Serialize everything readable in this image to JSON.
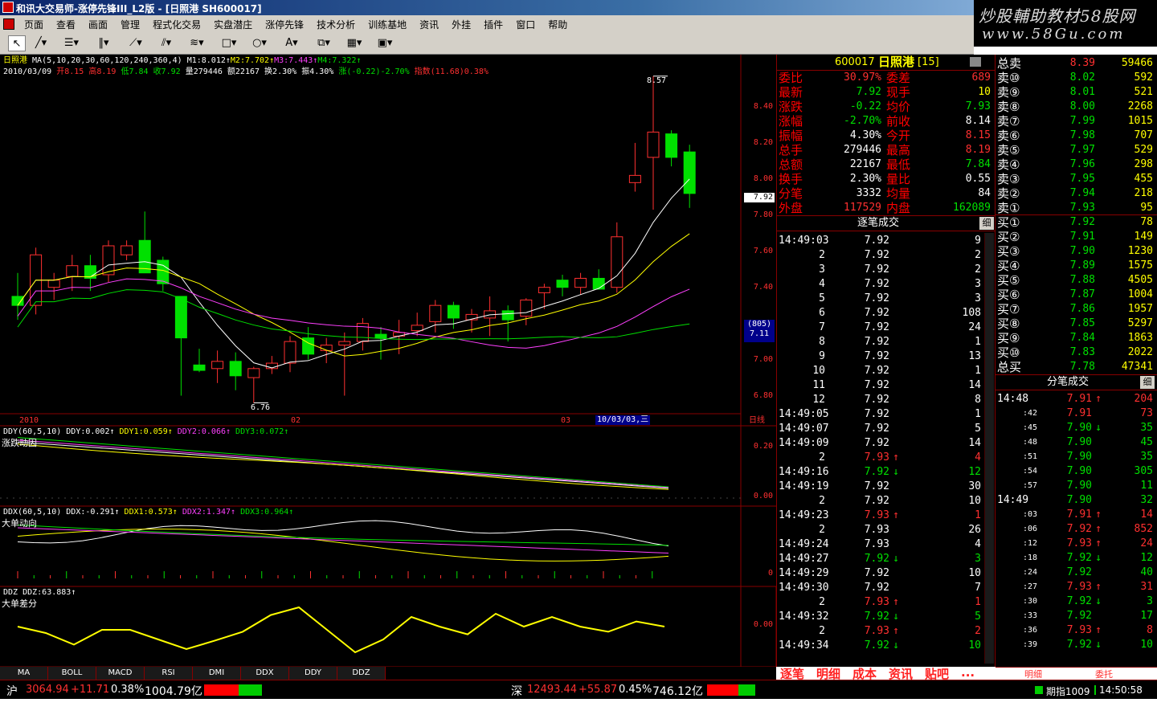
{
  "window": {
    "title": "和讯大交易师-涨停先锋III_L2版 - [日照港 SH600017]"
  },
  "watermark": {
    "line1": "炒股輔助教材58股网",
    "line2": "www.58Gu.com"
  },
  "menu": [
    "页面",
    "查看",
    "画面",
    "管理",
    "程式化交易",
    "实盘潜庄",
    "涨停先锋",
    "技术分析",
    "训练基地",
    "资讯",
    "外挂",
    "插件",
    "窗口",
    "帮助"
  ],
  "main_chart": {
    "stock_name": "日照港",
    "ma_line": "MA(5,10,20,30,60,120,240,360,4)",
    "ma_values": [
      {
        "text": "M1:8.012",
        "color": "#ffffff"
      },
      {
        "text": "M2:7.702",
        "color": "#ffff00"
      },
      {
        "text": "M3:7.443",
        "color": "#ff40ff"
      },
      {
        "text": "M4:7.322",
        "color": "#00e000"
      }
    ],
    "info_date": "2010/03/09",
    "info_items": [
      {
        "text": "开8.15",
        "color": "#ff3030"
      },
      {
        "text": "高8.19",
        "color": "#ff3030"
      },
      {
        "text": "低7.84",
        "color": "#00e000"
      },
      {
        "text": "收7.92",
        "color": "#00e000"
      },
      {
        "text": "量279446",
        "color": "#ffffff"
      },
      {
        "text": "额22167",
        "color": "#ffffff"
      },
      {
        "text": "换2.30%",
        "color": "#ffffff"
      },
      {
        "text": "振4.30%",
        "color": "#ffffff"
      },
      {
        "text": "涨(-0.22)-2.70%",
        "color": "#00e000"
      },
      {
        "text": "指数(11.68)0.38%",
        "color": "#ff3030"
      }
    ],
    "y_ticks": [
      "8.40",
      "8.20",
      "8.00",
      "7.80",
      "7.60",
      "7.40",
      "7.20",
      "7.00",
      "6.80"
    ],
    "current_price_tag": "7.92",
    "cursor_tag_top": "(805)",
    "cursor_tag_bottom": "7.11",
    "high_label": "8.57",
    "low_label": "6.76",
    "x_labels": [
      "2010",
      "02",
      "03"
    ],
    "date_tag": "10/03/03,三",
    "period": "日线"
  },
  "chart_data": {
    "type": "candlestick",
    "ylim": [
      6.7,
      8.6
    ],
    "candles": [
      {
        "o": 7.35,
        "h": 7.48,
        "l": 7.22,
        "c": 7.3
      },
      {
        "o": 7.3,
        "h": 7.62,
        "l": 7.25,
        "c": 7.58
      },
      {
        "o": 7.4,
        "h": 7.48,
        "l": 7.33,
        "c": 7.44
      },
      {
        "o": 7.46,
        "h": 7.58,
        "l": 7.38,
        "c": 7.52
      },
      {
        "o": 7.52,
        "h": 7.58,
        "l": 7.38,
        "c": 7.45
      },
      {
        "o": 7.47,
        "h": 7.66,
        "l": 7.43,
        "c": 7.63
      },
      {
        "o": 7.58,
        "h": 7.66,
        "l": 7.55,
        "c": 7.63
      },
      {
        "o": 7.66,
        "h": 7.82,
        "l": 7.52,
        "c": 7.48
      },
      {
        "o": 7.55,
        "h": 7.57,
        "l": 7.38,
        "c": 7.42
      },
      {
        "o": 7.35,
        "h": 7.35,
        "l": 6.8,
        "c": 7.12
      },
      {
        "o": 6.97,
        "h": 7.06,
        "l": 6.93,
        "c": 6.94
      },
      {
        "o": 6.95,
        "h": 7.05,
        "l": 6.87,
        "c": 6.99
      },
      {
        "o": 6.99,
        "h": 7.04,
        "l": 6.83,
        "c": 6.91
      },
      {
        "o": 6.9,
        "h": 6.96,
        "l": 6.76,
        "c": 6.95
      },
      {
        "o": 6.95,
        "h": 7.02,
        "l": 6.92,
        "c": 6.98
      },
      {
        "o": 6.98,
        "h": 7.13,
        "l": 6.93,
        "c": 7.1
      },
      {
        "o": 7.12,
        "h": 7.18,
        "l": 7.0,
        "c": 7.03
      },
      {
        "o": 7.05,
        "h": 7.12,
        "l": 6.98,
        "c": 7.08
      },
      {
        "o": 7.08,
        "h": 7.15,
        "l": 6.8,
        "c": 7.1
      },
      {
        "o": 7.1,
        "h": 7.23,
        "l": 7.05,
        "c": 7.2
      },
      {
        "o": 7.14,
        "h": 7.18,
        "l": 7.0,
        "c": 7.12
      },
      {
        "o": 7.13,
        "h": 7.22,
        "l": 7.03,
        "c": 7.15
      },
      {
        "o": 7.16,
        "h": 7.26,
        "l": 7.13,
        "c": 7.19
      },
      {
        "o": 7.21,
        "h": 7.33,
        "l": 7.15,
        "c": 7.3
      },
      {
        "o": 7.3,
        "h": 7.32,
        "l": 7.17,
        "c": 7.23
      },
      {
        "o": 7.22,
        "h": 7.28,
        "l": 7.15,
        "c": 7.25
      },
      {
        "o": 7.23,
        "h": 7.35,
        "l": 7.13,
        "c": 7.27
      },
      {
        "o": 7.27,
        "h": 7.3,
        "l": 7.1,
        "c": 7.22
      },
      {
        "o": 7.24,
        "h": 7.34,
        "l": 7.19,
        "c": 7.33
      },
      {
        "o": 7.37,
        "h": 7.42,
        "l": 7.28,
        "c": 7.4
      },
      {
        "o": 7.44,
        "h": 7.47,
        "l": 7.35,
        "c": 7.4
      },
      {
        "o": 7.4,
        "h": 7.48,
        "l": 7.36,
        "c": 7.45
      },
      {
        "o": 7.45,
        "h": 7.5,
        "l": 7.4,
        "c": 7.39
      },
      {
        "o": 7.4,
        "h": 7.76,
        "l": 7.37,
        "c": 7.68
      },
      {
        "o": 7.98,
        "h": 8.2,
        "l": 7.93,
        "c": 8.02
      },
      {
        "o": 8.12,
        "h": 8.57,
        "l": 7.83,
        "c": 8.26
      },
      {
        "o": 8.25,
        "h": 8.27,
        "l": 8.07,
        "c": 8.12
      },
      {
        "o": 8.15,
        "h": 8.19,
        "l": 7.84,
        "c": 7.92
      }
    ]
  },
  "ddy": {
    "title": "DDY(60,5,10)",
    "values": [
      {
        "text": "DDY:0.002",
        "color": "#ffffff"
      },
      {
        "text": "DDY1:0.059",
        "color": "#ffff00"
      },
      {
        "text": "DDY2:0.066",
        "color": "#ff40ff"
      },
      {
        "text": "DDY3:0.072",
        "color": "#00e000"
      }
    ],
    "label": "涨跌动因",
    "y_ticks": [
      "0.20",
      "0.00"
    ]
  },
  "ddx": {
    "title": "DDX(60,5,10)",
    "values": [
      {
        "text": "DDX:-0.291",
        "color": "#ffffff"
      },
      {
        "text": "DDX1:0.573",
        "color": "#ffff00"
      },
      {
        "text": "DDX2:1.347",
        "color": "#ff40ff"
      },
      {
        "text": "DDX3:0.964",
        "color": "#00e000"
      }
    ],
    "label": "大单动向",
    "y_tick": "0"
  },
  "ddz": {
    "title": "DDZ",
    "value": "DDZ:63.883",
    "label": "大单差分",
    "y_tick": "0.00"
  },
  "indicator_tabs": [
    "MA",
    "BOLL",
    "MACD",
    "RSI",
    "DMI",
    "DDX",
    "DDY",
    "DDZ"
  ],
  "quote": {
    "code": "600017",
    "name": "日照港",
    "level": "[15]",
    "stats": [
      {
        "l1": "委比",
        "v1": "30.97%",
        "c1": "#ff3030",
        "l2": "委差",
        "v2": "689",
        "c2": "#ff3030"
      },
      {
        "l1": "最新",
        "v1": "7.92",
        "c1": "#00e000",
        "l2": "现手",
        "v2": "10",
        "c2": "#ffff00"
      },
      {
        "l1": "涨跌",
        "v1": "-0.22",
        "c1": "#00e000",
        "l2": "均价",
        "v2": "7.93",
        "c2": "#00e000"
      },
      {
        "l1": "涨幅",
        "v1": "-2.70%",
        "c1": "#00e000",
        "l2": "前收",
        "v2": "8.14",
        "c2": "#ffffff"
      },
      {
        "l1": "振幅",
        "v1": "4.30%",
        "c1": "#ffffff",
        "l2": "今开",
        "v2": "8.15",
        "c2": "#ff3030"
      },
      {
        "l1": "总手",
        "v1": "279446",
        "c1": "#ffffff",
        "l2": "最高",
        "v2": "8.19",
        "c2": "#ff3030"
      },
      {
        "l1": "总额",
        "v1": "22167",
        "c1": "#ffffff",
        "l2": "最低",
        "v2": "7.84",
        "c2": "#00e000"
      },
      {
        "l1": "换手",
        "v1": "2.30%",
        "c1": "#ffffff",
        "l2": "量比",
        "v2": "0.55",
        "c2": "#ffffff"
      },
      {
        "l1": "分笔",
        "v1": "3332",
        "c1": "#ffffff",
        "l2": "均量",
        "v2": "84",
        "c2": "#ffffff"
      },
      {
        "l1": "外盘",
        "v1": "117529",
        "c1": "#ff3030",
        "l2": "内盘",
        "v2": "162089",
        "c2": "#00e000"
      }
    ],
    "ticks_title": "逐笔成交",
    "ticks_btn": "细",
    "ticks": [
      {
        "t": "14:49:03",
        "p": "7.92",
        "pc": "#ffffff",
        "a": "",
        "v": "9",
        "vc": "#ffffff"
      },
      {
        "t": "2",
        "p": "7.92",
        "pc": "#ffffff",
        "a": "",
        "v": "2",
        "vc": "#ffffff"
      },
      {
        "t": "3",
        "p": "7.92",
        "pc": "#ffffff",
        "a": "",
        "v": "2",
        "vc": "#ffffff"
      },
      {
        "t": "4",
        "p": "7.92",
        "pc": "#ffffff",
        "a": "",
        "v": "3",
        "vc": "#ffffff"
      },
      {
        "t": "5",
        "p": "7.92",
        "pc": "#ffffff",
        "a": "",
        "v": "3",
        "vc": "#ffffff"
      },
      {
        "t": "6",
        "p": "7.92",
        "pc": "#ffffff",
        "a": "",
        "v": "108",
        "vc": "#ffffff"
      },
      {
        "t": "7",
        "p": "7.92",
        "pc": "#ffffff",
        "a": "",
        "v": "24",
        "vc": "#ffffff"
      },
      {
        "t": "8",
        "p": "7.92",
        "pc": "#ffffff",
        "a": "",
        "v": "1",
        "vc": "#ffffff"
      },
      {
        "t": "9",
        "p": "7.92",
        "pc": "#ffffff",
        "a": "",
        "v": "13",
        "vc": "#ffffff"
      },
      {
        "t": "10",
        "p": "7.92",
        "pc": "#ffffff",
        "a": "",
        "v": "1",
        "vc": "#ffffff"
      },
      {
        "t": "11",
        "p": "7.92",
        "pc": "#ffffff",
        "a": "",
        "v": "14",
        "vc": "#ffffff"
      },
      {
        "t": "12",
        "p": "7.92",
        "pc": "#ffffff",
        "a": "",
        "v": "8",
        "vc": "#ffffff"
      },
      {
        "t": "14:49:05",
        "p": "7.92",
        "pc": "#ffffff",
        "a": "",
        "v": "1",
        "vc": "#ffffff"
      },
      {
        "t": "14:49:07",
        "p": "7.92",
        "pc": "#ffffff",
        "a": "",
        "v": "5",
        "vc": "#ffffff"
      },
      {
        "t": "14:49:09",
        "p": "7.92",
        "pc": "#ffffff",
        "a": "",
        "v": "14",
        "vc": "#ffffff"
      },
      {
        "t": "2",
        "p": "7.93",
        "pc": "#ff3030",
        "a": "↑",
        "v": "4",
        "vc": "#ff3030"
      },
      {
        "t": "14:49:16",
        "p": "7.92",
        "pc": "#00e000",
        "a": "↓",
        "v": "12",
        "vc": "#00e000"
      },
      {
        "t": "14:49:19",
        "p": "7.92",
        "pc": "#ffffff",
        "a": "",
        "v": "30",
        "vc": "#ffffff"
      },
      {
        "t": "2",
        "p": "7.92",
        "pc": "#ffffff",
        "a": "",
        "v": "10",
        "vc": "#ffffff"
      },
      {
        "t": "14:49:23",
        "p": "7.93",
        "pc": "#ff3030",
        "a": "↑",
        "v": "1",
        "vc": "#ff3030"
      },
      {
        "t": "2",
        "p": "7.93",
        "pc": "#ffffff",
        "a": "",
        "v": "26",
        "vc": "#ffffff"
      },
      {
        "t": "14:49:24",
        "p": "7.93",
        "pc": "#ffffff",
        "a": "",
        "v": "4",
        "vc": "#ffffff"
      },
      {
        "t": "14:49:27",
        "p": "7.92",
        "pc": "#00e000",
        "a": "↓",
        "v": "3",
        "vc": "#00e000"
      },
      {
        "t": "14:49:29",
        "p": "7.92",
        "pc": "#ffffff",
        "a": "",
        "v": "10",
        "vc": "#ffffff"
      },
      {
        "t": "14:49:30",
        "p": "7.92",
        "pc": "#ffffff",
        "a": "",
        "v": "7",
        "vc": "#ffffff"
      },
      {
        "t": "2",
        "p": "7.93",
        "pc": "#ff3030",
        "a": "↑",
        "v": "1",
        "vc": "#ff3030"
      },
      {
        "t": "14:49:32",
        "p": "7.92",
        "pc": "#00e000",
        "a": "↓",
        "v": "5",
        "vc": "#00e000"
      },
      {
        "t": "2",
        "p": "7.93",
        "pc": "#ff3030",
        "a": "↑",
        "v": "2",
        "vc": "#ff3030"
      },
      {
        "t": "14:49:34",
        "p": "7.92",
        "pc": "#00e000",
        "a": "↓",
        "v": "10",
        "vc": "#00e000"
      }
    ],
    "bottom_tabs": [
      "逐笔",
      "明细",
      "成本",
      "资讯",
      "贴吧",
      "..."
    ]
  },
  "orderbook": {
    "total_sell": {
      "label": "总卖",
      "price": "8.39",
      "vol": "59466"
    },
    "sells": [
      {
        "l": "卖⑩",
        "p": "8.02",
        "v": "592"
      },
      {
        "l": "卖⑨",
        "p": "8.01",
        "v": "521"
      },
      {
        "l": "卖⑧",
        "p": "8.00",
        "v": "2268"
      },
      {
        "l": "卖⑦",
        "p": "7.99",
        "v": "1015"
      },
      {
        "l": "卖⑥",
        "p": "7.98",
        "v": "707"
      },
      {
        "l": "卖⑤",
        "p": "7.97",
        "v": "529"
      },
      {
        "l": "卖④",
        "p": "7.96",
        "v": "298"
      },
      {
        "l": "卖③",
        "p": "7.95",
        "v": "455"
      },
      {
        "l": "卖②",
        "p": "7.94",
        "v": "218"
      },
      {
        "l": "卖①",
        "p": "7.93",
        "v": "95"
      }
    ],
    "buys": [
      {
        "l": "买①",
        "p": "7.92",
        "v": "78"
      },
      {
        "l": "买②",
        "p": "7.91",
        "v": "149"
      },
      {
        "l": "买③",
        "p": "7.90",
        "v": "1230"
      },
      {
        "l": "买④",
        "p": "7.89",
        "v": "1575"
      },
      {
        "l": "买⑤",
        "p": "7.88",
        "v": "4505"
      },
      {
        "l": "买⑥",
        "p": "7.87",
        "v": "1004"
      },
      {
        "l": "买⑦",
        "p": "7.86",
        "v": "1957"
      },
      {
        "l": "买⑧",
        "p": "7.85",
        "v": "5297"
      },
      {
        "l": "买⑨",
        "p": "7.84",
        "v": "1863"
      },
      {
        "l": "买⑩",
        "p": "7.83",
        "v": "2022"
      }
    ],
    "total_buy": {
      "label": "总买",
      "price": "7.78",
      "vol": "47341"
    },
    "trades_title": "分笔成交",
    "trades_btn": "细",
    "trades": [
      {
        "t": "14:48",
        "p": "7.91",
        "pc": "#ff3030",
        "a": "↑",
        "v": "204",
        "vc": "#ff3030",
        "big": true
      },
      {
        "t": ":42",
        "p": "7.91",
        "pc": "#ff3030",
        "a": "",
        "v": "73",
        "vc": "#ff3030",
        "big": false
      },
      {
        "t": ":45",
        "p": "7.90",
        "pc": "#00e000",
        "a": "↓",
        "v": "35",
        "vc": "#00e000",
        "big": false
      },
      {
        "t": ":48",
        "p": "7.90",
        "pc": "#00e000",
        "a": "",
        "v": "45",
        "vc": "#00e000",
        "big": false
      },
      {
        "t": ":51",
        "p": "7.90",
        "pc": "#00e000",
        "a": "",
        "v": "35",
        "vc": "#00e000",
        "big": false
      },
      {
        "t": ":54",
        "p": "7.90",
        "pc": "#00e000",
        "a": "",
        "v": "305",
        "vc": "#00e000",
        "big": false
      },
      {
        "t": ":57",
        "p": "7.90",
        "pc": "#00e000",
        "a": "",
        "v": "11",
        "vc": "#00e000",
        "big": false
      },
      {
        "t": "14:49",
        "p": "7.90",
        "pc": "#00e000",
        "a": "",
        "v": "32",
        "vc": "#00e000",
        "big": true
      },
      {
        "t": ":03",
        "p": "7.91",
        "pc": "#ff3030",
        "a": "↑",
        "v": "14",
        "vc": "#ff3030",
        "big": false
      },
      {
        "t": ":06",
        "p": "7.92",
        "pc": "#ff3030",
        "a": "↑",
        "v": "852",
        "vc": "#ff3030",
        "big": false
      },
      {
        "t": ":12",
        "p": "7.93",
        "pc": "#ff3030",
        "a": "↑",
        "v": "24",
        "vc": "#ff3030",
        "big": false
      },
      {
        "t": ":18",
        "p": "7.92",
        "pc": "#00e000",
        "a": "↓",
        "v": "12",
        "vc": "#00e000",
        "big": false
      },
      {
        "t": ":24",
        "p": "7.92",
        "pc": "#00e000",
        "a": "",
        "v": "40",
        "vc": "#00e000",
        "big": false
      },
      {
        "t": ":27",
        "p": "7.93",
        "pc": "#ff3030",
        "a": "↑",
        "v": "31",
        "vc": "#ff3030",
        "big": false
      },
      {
        "t": ":30",
        "p": "7.92",
        "pc": "#00e000",
        "a": "↓",
        "v": "3",
        "vc": "#00e000",
        "big": false
      },
      {
        "t": ":33",
        "p": "7.92",
        "pc": "#00e000",
        "a": "",
        "v": "17",
        "vc": "#00e000",
        "big": false
      },
      {
        "t": ":36",
        "p": "7.93",
        "pc": "#ff3030",
        "a": "↑",
        "v": "8",
        "vc": "#ff3030",
        "big": false
      },
      {
        "t": ":39",
        "p": "7.92",
        "pc": "#00e000",
        "a": "↓",
        "v": "10",
        "vc": "#00e000",
        "big": false
      }
    ],
    "bottom_tabs": [
      "明细",
      "委托"
    ]
  },
  "status": {
    "sh_label": "沪",
    "sh_index": "3064.94",
    "sh_change": "+11.71",
    "sh_pct": "0.38%",
    "sh_amount": "1004.79亿",
    "sz_label": "深",
    "sz_index": "12493.44",
    "sz_change": "+55.87",
    "sz_pct": "0.45%",
    "sz_amount": "746.12亿",
    "futures": "期指1009",
    "time": "14:50:58"
  }
}
